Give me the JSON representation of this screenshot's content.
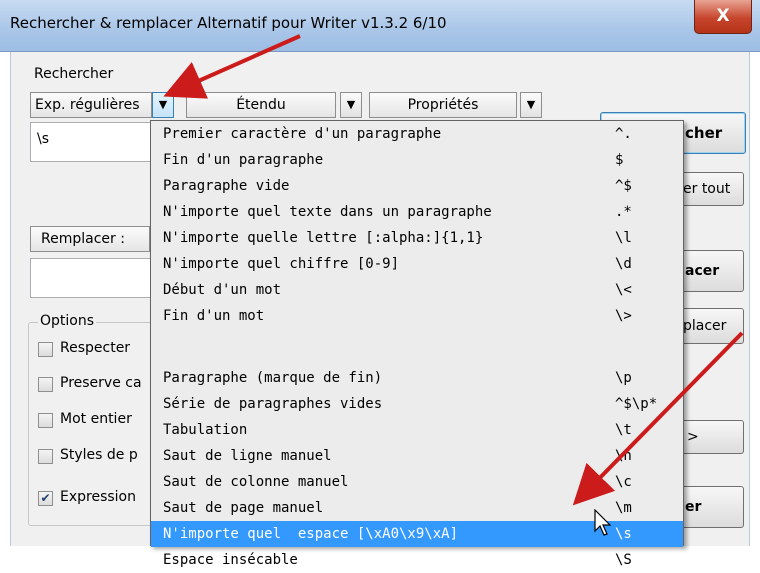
{
  "window": {
    "title": "Rechercher & remplacer Alternatif pour Writer v1.3.2  6/10",
    "close_label": "X"
  },
  "search": {
    "label": "Rechercher",
    "mode_combo": "Exp. régulières",
    "scope_combo": "Étendu",
    "props_combo": "Propriétés",
    "value": "\\s"
  },
  "replace": {
    "combo_label": "Remplacer :",
    "value": ""
  },
  "options": {
    "title": "Options",
    "items": [
      {
        "label": "Respecter ",
        "checked": false
      },
      {
        "label": "Preserve ca",
        "checked": false
      },
      {
        "label": "Mot entier",
        "checked": false
      },
      {
        "label": "Styles de p",
        "checked": false
      },
      {
        "label": "Expression",
        "checked": true
      }
    ]
  },
  "buttons": {
    "find": "cher",
    "find_all": "er tout",
    "replace": "acer",
    "replace_all": "placer",
    "more": ">",
    "close": "er"
  },
  "menu": {
    "items": [
      {
        "text": "Premier caractère d'un paragraphe",
        "syntax": "^."
      },
      {
        "text": "Fin d'un paragraphe",
        "syntax": "$"
      },
      {
        "text": "Paragraphe vide",
        "syntax": "^$"
      },
      {
        "text": "N'importe quel texte dans un paragraphe",
        "syntax": ".*"
      },
      {
        "text": "N'importe quelle lettre [:alpha:]{1,1}",
        "syntax": "\\l"
      },
      {
        "text": "N'importe quel chiffre [0-9]",
        "syntax": "\\d"
      },
      {
        "text": "Début d'un mot",
        "syntax": "\\<"
      },
      {
        "text": "Fin d'un mot",
        "syntax": "\\>"
      },
      {
        "text": "",
        "syntax": ""
      },
      {
        "text": "Paragraphe (marque de fin)",
        "syntax": "\\p"
      },
      {
        "text": "Série de paragraphes vides",
        "syntax": "^$\\p*"
      },
      {
        "text": "Tabulation",
        "syntax": "\\t"
      },
      {
        "text": "Saut de ligne manuel",
        "syntax": "\\n"
      },
      {
        "text": "Saut de colonne manuel",
        "syntax": "\\c"
      },
      {
        "text": "Saut de page manuel",
        "syntax": "\\m"
      },
      {
        "text": "N'importe quel  espace [\\xA0\\x9\\xA]",
        "syntax": "\\s"
      },
      {
        "text": "Espace insécable",
        "syntax": "\\S"
      }
    ],
    "selected_index": 15
  },
  "colors": {
    "selection": "#3399ff",
    "arrow": "#cc1b1b"
  }
}
